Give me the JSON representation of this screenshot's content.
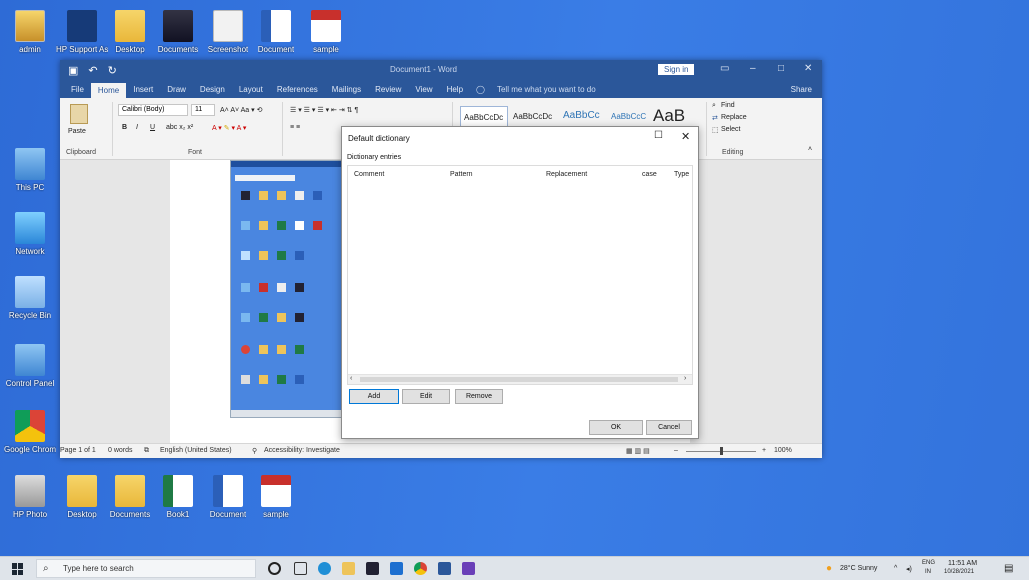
{
  "desktop": {
    "icons": [
      {
        "label": "admin",
        "glyph": "user-folder-icon"
      },
      {
        "label": "HP Support Assistant",
        "glyph": "hp-icon"
      },
      {
        "label": "Desktop",
        "glyph": "folder-icon"
      },
      {
        "label": "Documents",
        "glyph": "folder-icon"
      },
      {
        "label": "Screenshot",
        "glyph": "document-icon"
      },
      {
        "label": "Document",
        "glyph": "word-icon"
      },
      {
        "label": "sample",
        "glyph": "pdf-icon"
      },
      {
        "label": "This PC",
        "glyph": "computer-icon"
      },
      {
        "label": "Network",
        "glyph": "network-icon"
      },
      {
        "label": "Recycle Bin",
        "glyph": "recycle-bin-icon"
      },
      {
        "label": "Control Panel",
        "glyph": "control-panel-icon"
      },
      {
        "label": "Google Chrome",
        "glyph": "chrome-icon"
      },
      {
        "label": "HP Photo",
        "glyph": "camera-icon"
      },
      {
        "label": "Desktop",
        "glyph": "folder-icon"
      },
      {
        "label": "Documents",
        "glyph": "folder-icon"
      },
      {
        "label": "Book1",
        "glyph": "excel-icon"
      },
      {
        "label": "Document",
        "glyph": "word-icon"
      },
      {
        "label": "sample",
        "glyph": "pdf-icon"
      }
    ]
  },
  "word": {
    "title": "Document1 - Word",
    "sign_in": "Sign in",
    "menu": [
      "File",
      "Home",
      "Insert",
      "Draw",
      "Design",
      "Layout",
      "References",
      "Mailings",
      "Review",
      "View",
      "Help"
    ],
    "tell_me": "Tell me what you want to do",
    "share": "Share",
    "ribbon": {
      "paste": "Paste",
      "clipboard": "Clipboard",
      "font_name": "Calibri (Body)",
      "font_size": "11",
      "font_group": "Font",
      "bold": "B",
      "italic": "I",
      "underline": "U",
      "styles": [
        "AaBbCcDc",
        "AaBbCcDc",
        "AaBbCc",
        "AaBbCcC",
        "AaB"
      ],
      "find": "Find",
      "replace": "Replace",
      "select": "Select",
      "editing": "Editing"
    },
    "status": {
      "page": "Page 1 of 1",
      "words": "0 words",
      "language": "English (United States)",
      "accessibility": "Accessibility: Investigate",
      "zoom": "100%"
    }
  },
  "dialog": {
    "title": "Default dictionary",
    "entries_label": "Dictionary entries",
    "columns": [
      "Comment",
      "Pattern",
      "Replacement",
      "case",
      "Type"
    ],
    "buttons": {
      "add": "Add",
      "edit": "Edit",
      "remove": "Remove",
      "ok": "OK",
      "cancel": "Cancel"
    }
  },
  "taskbar": {
    "search_placeholder": "Type here to search",
    "weather": "28°C Sunny",
    "lang": "ENG",
    "region": "IN",
    "time": "11:51 AM",
    "date": "10/28/2021"
  },
  "colors": {
    "word_blue": "#2b579a",
    "desktop": "#3a7de6",
    "taskbar": "#dfe4ea"
  }
}
